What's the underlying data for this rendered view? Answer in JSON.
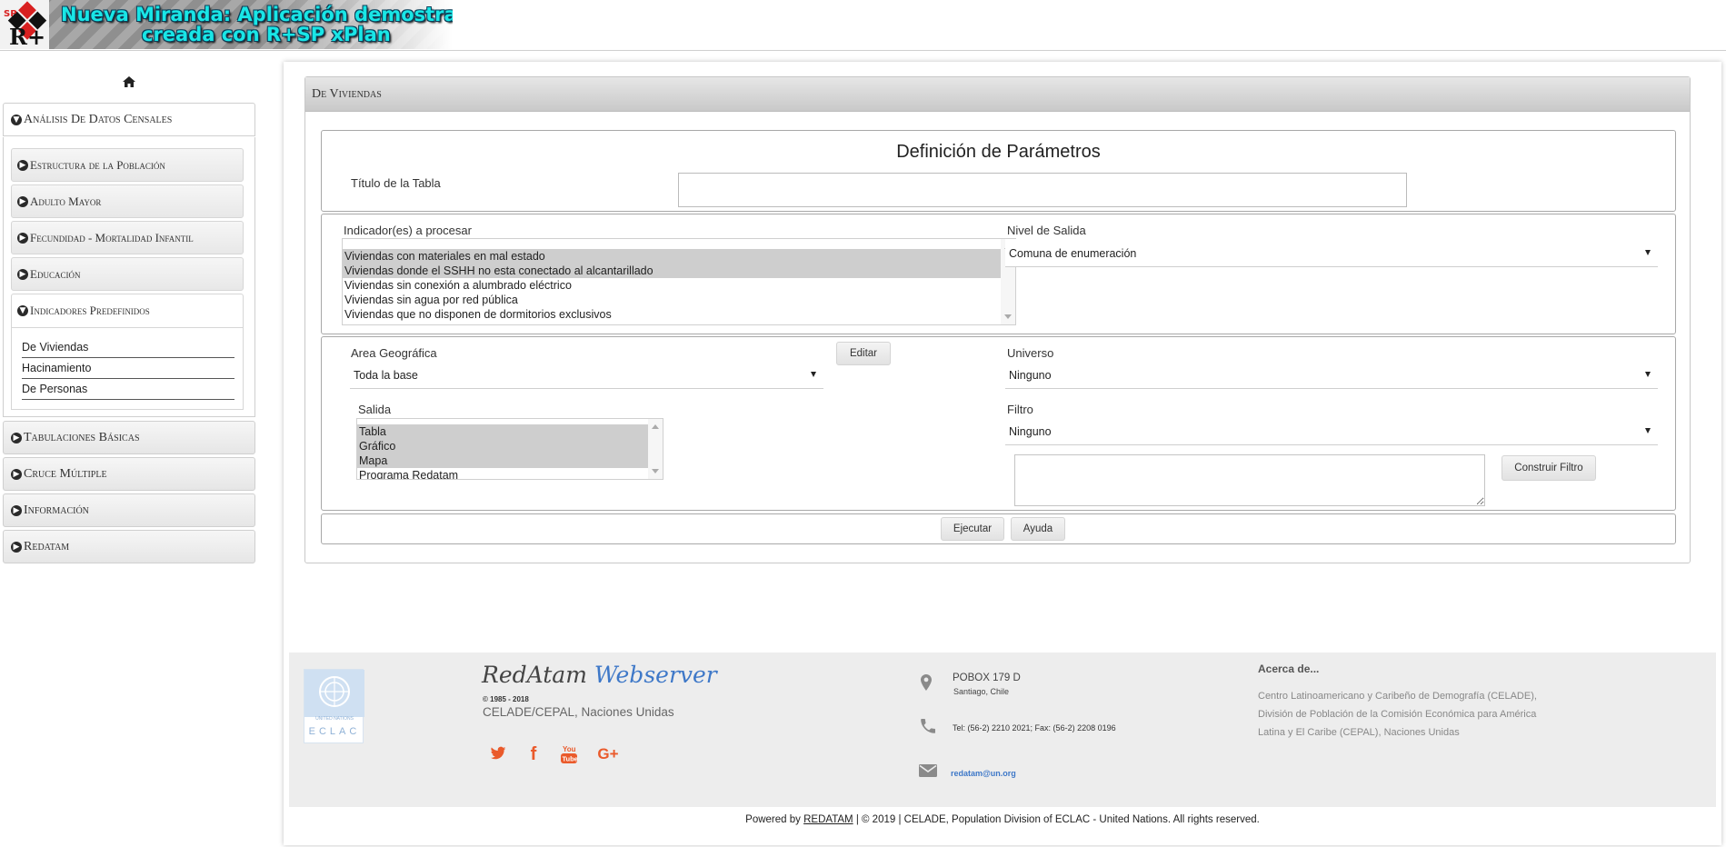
{
  "header": {
    "title_line1": "Nueva Miranda: Aplicación demostrativa",
    "title_line2": "creada con R+SP xPlan",
    "logo_text": "SP R+"
  },
  "sidebar": {
    "home_icon": "home-icon",
    "sections": [
      {
        "label": "Análisis De Datos Censales",
        "icon": "circle-arrow-down-icon",
        "expanded": true
      },
      {
        "label": "Tabulaciones Básicas",
        "icon": "circle-arrow-right-icon"
      },
      {
        "label": "Cruce Múltiple",
        "icon": "circle-arrow-right-icon"
      },
      {
        "label": "Información",
        "icon": "circle-arrow-right-icon"
      },
      {
        "label": "Redatam",
        "icon": "circle-arrow-right-icon"
      }
    ],
    "subsections": [
      {
        "label": "Estructura de la Población"
      },
      {
        "label": "Adulto Mayor"
      },
      {
        "label": "Fecundidad - Mortalidad Infantil"
      },
      {
        "label": "Educación"
      },
      {
        "label": "Indicadores Predefinidos",
        "expanded": true
      }
    ],
    "predefined_links": [
      "De Viviendas",
      "Hacinamiento",
      "De Personas"
    ]
  },
  "panel": {
    "heading": "De Viviendas",
    "params_title": "Definición de Parámetros",
    "table_title_label": "Título de la Tabla",
    "table_title_value": "",
    "indicators_label": "Indicador(es) a procesar",
    "indicators": [
      {
        "label": "Viviendas con materiales en mal estado",
        "selected": true
      },
      {
        "label": "Viviendas donde el SSHH no esta conectado al alcantarillado",
        "selected": true
      },
      {
        "label": "Viviendas sin conexión a alumbrado eléctrico",
        "selected": false
      },
      {
        "label": "Viviendas sin agua por red pública",
        "selected": false
      },
      {
        "label": "Viviendas que no disponen de dormitorios exclusivos",
        "selected": false
      }
    ],
    "output_level_label": "Nivel de Salida",
    "output_level_value": "Comuna de enumeración",
    "geo_area_label": "Area Geográfica",
    "geo_area_value": "Toda la base",
    "edit_button": "Editar",
    "universe_label": "Universo",
    "universe_value": "Ninguno",
    "output_label": "Salida",
    "outputs": [
      {
        "label": "Tabla",
        "selected": true
      },
      {
        "label": "Gráfico",
        "selected": true
      },
      {
        "label": "Mapa",
        "selected": true
      },
      {
        "label": "Programa Redatam",
        "selected": false
      }
    ],
    "filter_label": "Filtro",
    "filter_value": "Ninguno",
    "filter_text": "",
    "build_filter_button": "Construir Filtro",
    "run_button": "Ejecutar",
    "help_button": "Ayuda"
  },
  "footer": {
    "brand_part1": "RedAtam",
    "brand_part2": "Webserver",
    "years": "© 1985 - 2018",
    "org": "CELADE/CEPAL, Naciones Unidas",
    "logo_caption": "ECLAC",
    "logo_small": "UNITED NATIONS",
    "social": [
      "twitter-icon",
      "facebook-icon",
      "youtube-icon",
      "google-plus-icon"
    ],
    "address_line1": "POBOX 179 D",
    "address_line2": "Santiago, Chile",
    "phone": "Tel: (56-2) 2210 2021; Fax: (56-2) 2208 0196",
    "email": "redatam@un.org",
    "about_title": "Acerca de...",
    "about_lines": [
      "Centro Latinoamericano y Caribeño de Demografía (CELADE),",
      "División de Población de la Comisión Económica para América",
      "Latina y El Caribe (CEPAL), Naciones Unidas"
    ],
    "copyright_prefix": "Powered by",
    "copyright_link": "REDATAM",
    "copyright_suffix": "| © 2019 | CELADE, Population Division of ECLAC - United Nations. All rights reserved."
  },
  "colors": {
    "banner_text": "#19e6e6",
    "social_accent": "#ea5a2b",
    "brand_blue": "#3e78c8",
    "brand_dark": "#444444",
    "selected_option": "#cecece"
  }
}
